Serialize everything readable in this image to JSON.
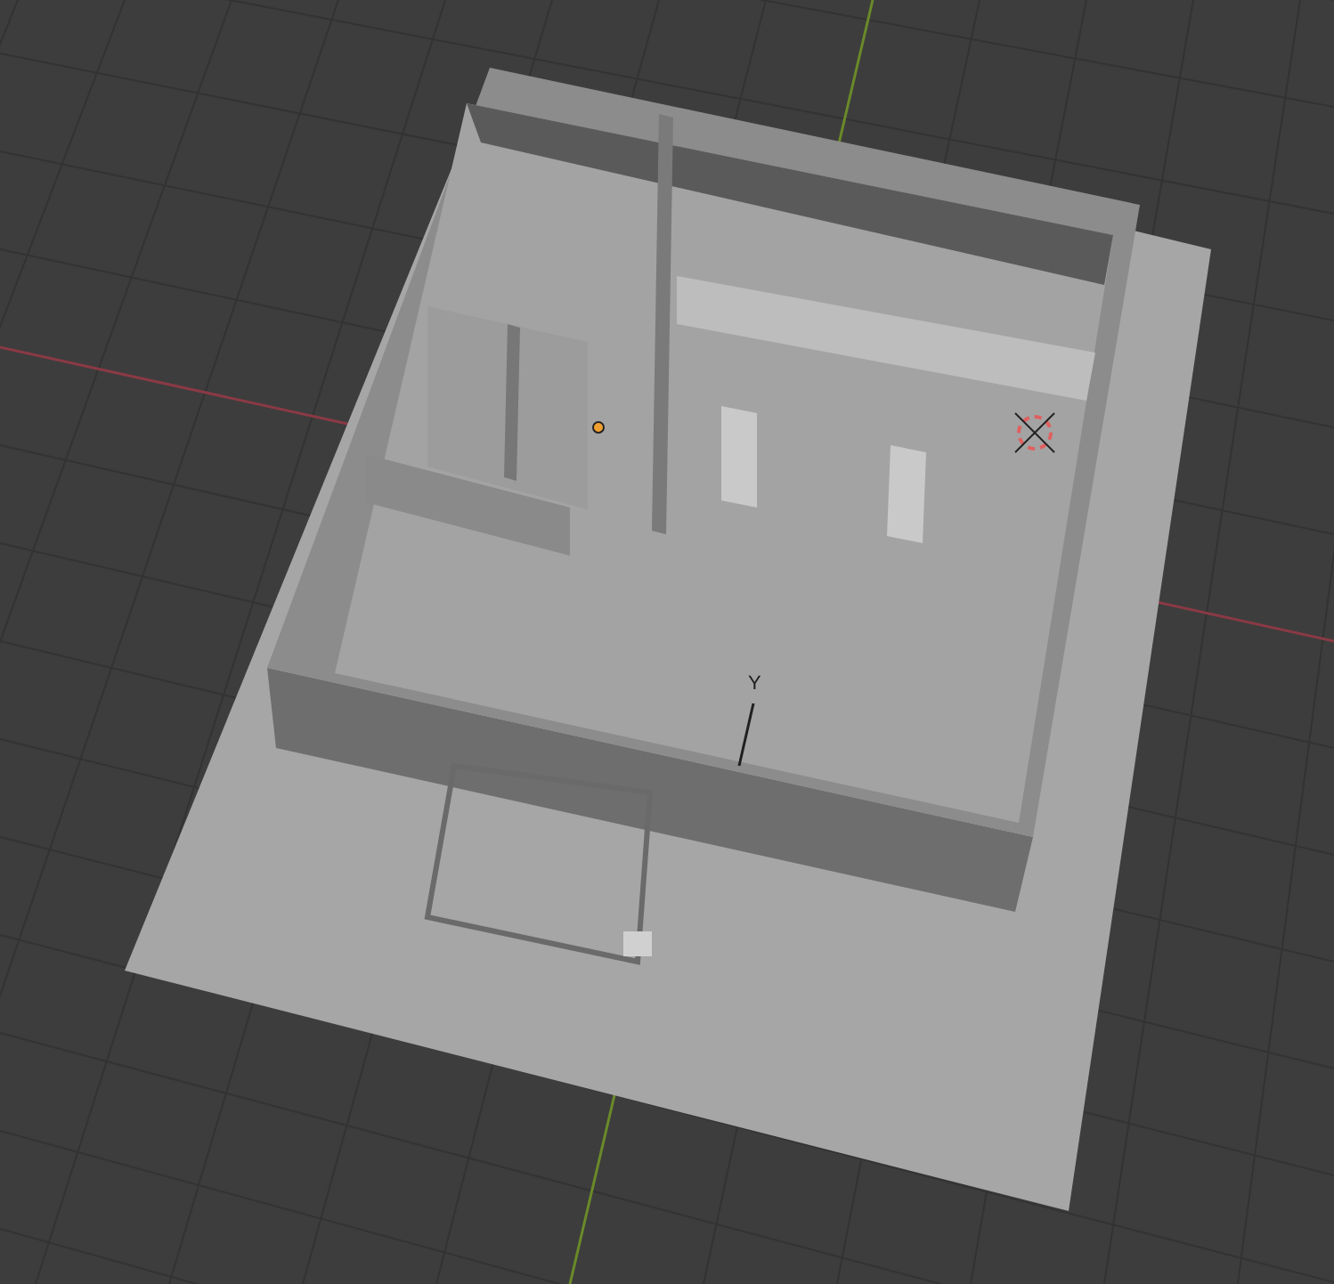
{
  "viewport": {
    "axis_labels": [
      {
        "text": "Y"
      }
    ]
  }
}
